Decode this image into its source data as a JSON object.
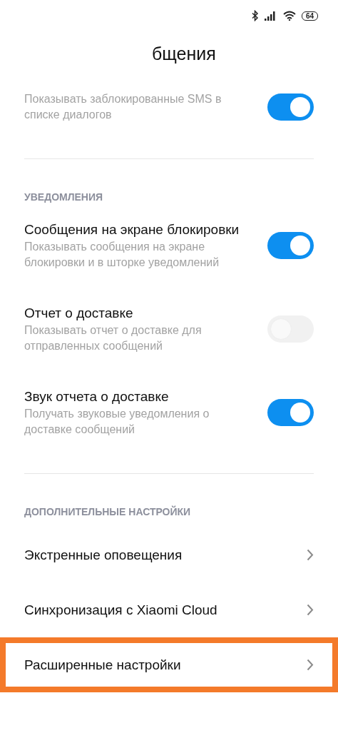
{
  "status_bar": {
    "battery": "64"
  },
  "header": {
    "title": "бщения"
  },
  "sections": [
    {
      "items": [
        {
          "kind": "toggle",
          "description": "Показывать заблокированные SMS в списке диалогов",
          "on": true
        }
      ]
    },
    {
      "header": "УВЕДОМЛЕНИЯ",
      "items": [
        {
          "kind": "toggle",
          "title": "Сообщения на экране блокировки",
          "description": "Показывать сообщения на экране блокировки и в шторке уведомлений",
          "on": true
        },
        {
          "kind": "toggle",
          "title": "Отчет о доставке",
          "description": "Показывать отчет о доставке для отправленных сообщений",
          "on": false
        },
        {
          "kind": "toggle",
          "title": "Звук отчета о доставке",
          "description": "Получать звуковые уведомления о доставке сообщений",
          "on": true
        }
      ]
    },
    {
      "header": "ДОПОЛНИТЕЛЬНЫЕ НАСТРОЙКИ",
      "items": [
        {
          "kind": "link",
          "title": "Экстренные оповещения",
          "highlighted": false
        },
        {
          "kind": "link",
          "title": "Синхронизация с Xiaomi Cloud",
          "highlighted": false
        },
        {
          "kind": "link",
          "title": "Расширенные настройки",
          "highlighted": true
        }
      ]
    }
  ]
}
